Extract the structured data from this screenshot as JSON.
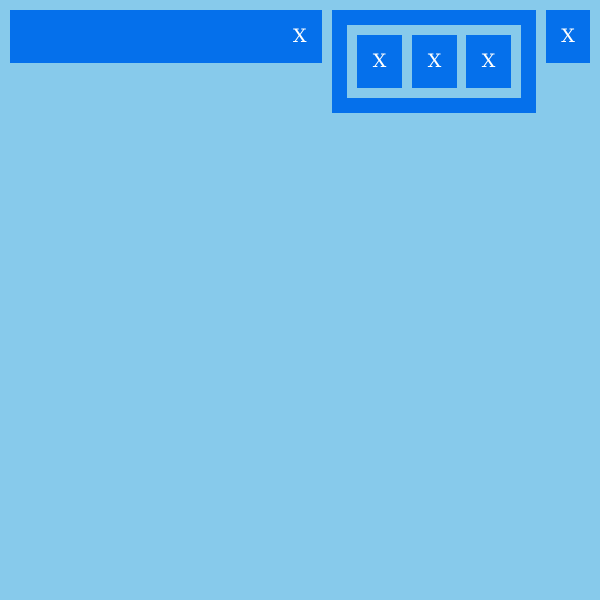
{
  "colors": {
    "background": "#87CAEB",
    "accent": "#0570EB",
    "text": "#FFFFFF"
  },
  "bar_left": {
    "close_label": "X"
  },
  "group": {
    "buttons": [
      {
        "label": "X"
      },
      {
        "label": "X"
      },
      {
        "label": "X"
      }
    ]
  },
  "right_button": {
    "label": "X"
  }
}
